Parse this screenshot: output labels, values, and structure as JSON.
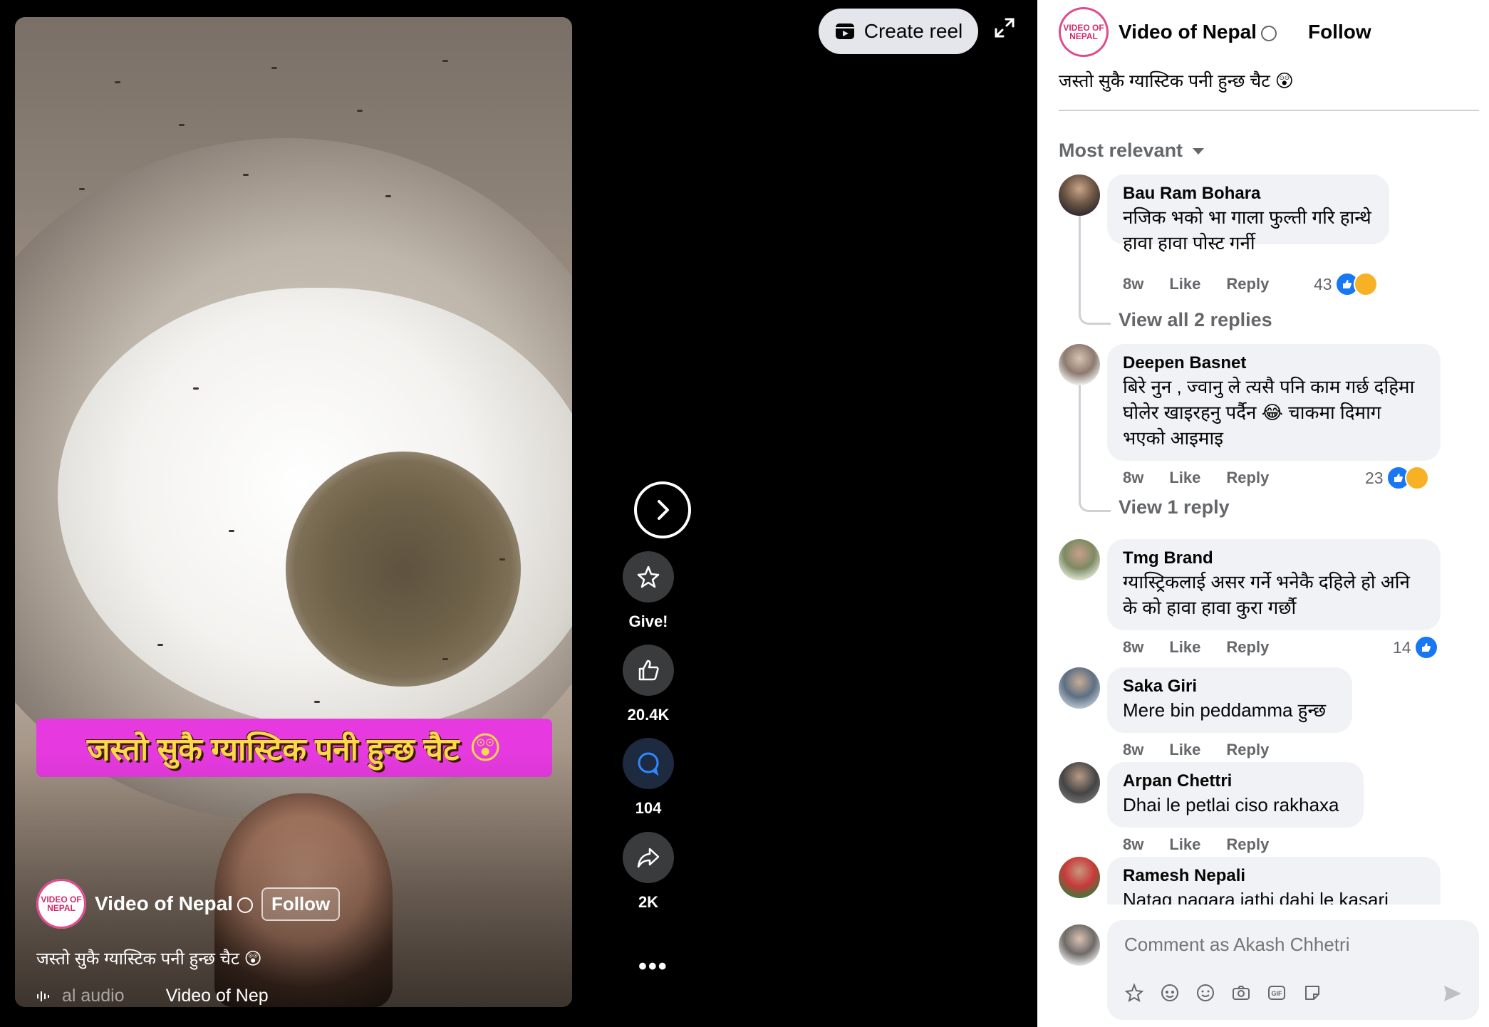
{
  "top_bar": {
    "create_reel_label": "Create reel"
  },
  "video": {
    "banner_text": "जस्तो सुकै ग्यास्टिक पनी हुन्छ चैट",
    "banner_emoji": "😲",
    "author_name": "Video of Nepal",
    "logo_text": "VIDEO OF NEPAL",
    "follow_label": "Follow",
    "caption": "जस्तो सुकै ग्यास्टिक पनी हुन्छ चैट 😲",
    "audio_left": "al audio",
    "audio_right": "Video of Nep"
  },
  "actions": {
    "give_label": "Give!",
    "like_count": "20.4K",
    "comment_count": "104",
    "share_count": "2K"
  },
  "panel": {
    "author_name": "Video of Nepal",
    "logo_text": "VIDEO OF NEPAL",
    "follow_label": "Follow",
    "caption": "जस्तो सुकै ग्यास्टिक पनी हुन्छ चैट 😲",
    "sort_label": "Most relevant",
    "comments": [
      {
        "author": "Bau Ram Bohara",
        "text": "नजिक भको भा गाला फुल्ती गरि हान्थे हावा हावा पोस्ट गर्नी",
        "time": "8w",
        "like": "Like",
        "reply": "Reply",
        "reaction_count": "43",
        "view_replies": "View all 2 replies"
      },
      {
        "author": "Deepen Basnet",
        "text": "बिरे नुन , ज्वानु ले त्यसै पनि काम गर्छ दहिमा घोलेर खाइरहनु पर्दैन 😂 चाकमा दिमाग भएको आइमाइ",
        "time": "8w",
        "like": "Like",
        "reply": "Reply",
        "reaction_count": "23",
        "view_replies": "View 1 reply"
      },
      {
        "author": "Tmg Brand",
        "text": "ग्यास्ट्रिकलाई असर गर्ने भनेकै दहिले हो अनि के को हावा हावा कुरा गर्छौ",
        "time": "8w",
        "like": "Like",
        "reply": "Reply",
        "reaction_count": "14"
      },
      {
        "author": "Saka Giri",
        "text": "Mere bin peddamma हुन्छ",
        "time": "8w",
        "like": "Like",
        "reply": "Reply"
      },
      {
        "author": "Arpan Chettri",
        "text": "Dhai le petlai ciso rakhaxa",
        "time": "8w",
        "like": "Like",
        "reply": "Reply"
      },
      {
        "author": "Ramesh Nepali",
        "text": "Natag nagara jathi dahi le kasari"
      }
    ],
    "composer_placeholder": "Comment as Akash Chhetri"
  },
  "colors": {
    "accent_blue": "#1877f2",
    "banner_magenta": "#e63ae0",
    "banner_text_yellow": "#ffd84a",
    "bubble_gray": "#f0f2f5",
    "meta_gray": "#65676b"
  }
}
